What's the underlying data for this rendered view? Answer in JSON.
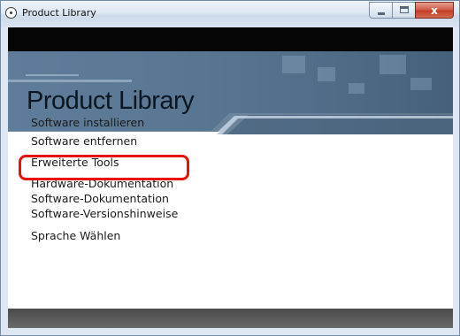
{
  "window": {
    "title": "Product Library",
    "close_glyph": "x",
    "icons": {
      "app": "cd-disc-icon",
      "minimize": "minimize-icon",
      "maximize": "maximize-icon",
      "close": "close-icon"
    }
  },
  "banner": {
    "title": "Product Library"
  },
  "menu": {
    "items": [
      {
        "label": "Software installieren"
      },
      {
        "label": "Software entfernen"
      },
      {
        "label": "Erweiterte Tools"
      },
      {
        "label": "Hardware-Dokumentation"
      },
      {
        "label": "Software-Dokumentation"
      },
      {
        "label": "Software-Versionshinweise"
      },
      {
        "label": "Sprache Wählen"
      }
    ],
    "highlighted_index": 1
  },
  "colors": {
    "highlight": "#e8110f",
    "banner": "#5a7894",
    "header_band": "#050505",
    "footer": "#5a5a5a"
  }
}
